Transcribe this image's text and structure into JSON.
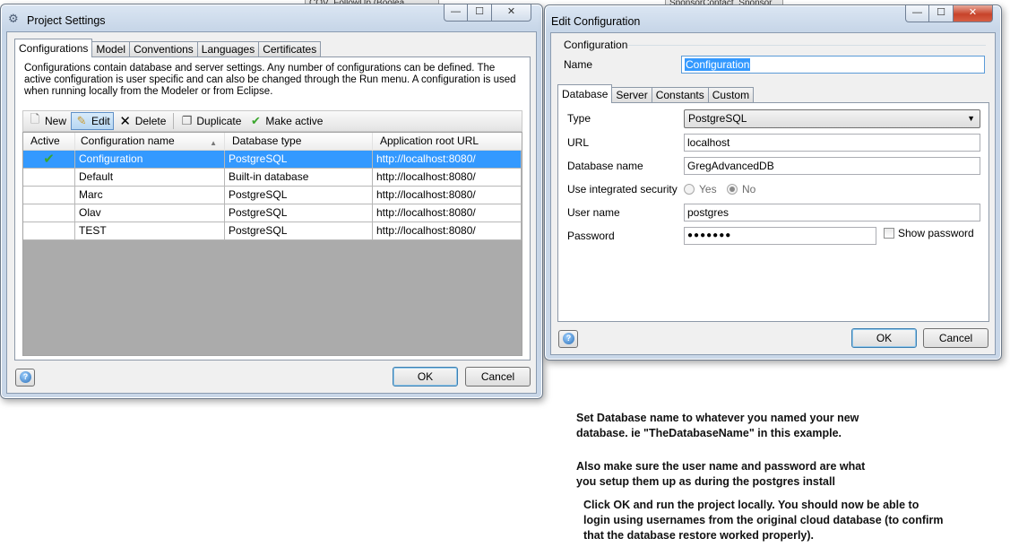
{
  "background": {
    "strip1": "COV_FollowUp (Boolea...",
    "strip2": "SponsorContact_Sponsor"
  },
  "project_settings": {
    "title": "Project Settings",
    "window_buttons": {
      "minimize": "—",
      "maximize": "☐",
      "close": "✕"
    },
    "tabs": [
      "Configurations",
      "Model",
      "Conventions",
      "Languages",
      "Certificates"
    ],
    "description": "Configurations contain database and server settings. Any number of configurations can be defined. The active configuration is user specific and can also be changed through the Run menu. A configuration is used when running locally from the Modeler or from Eclipse.",
    "toolbar": {
      "new": "New",
      "edit": "Edit",
      "delete": "Delete",
      "duplicate": "Duplicate",
      "make_active": "Make active"
    },
    "columns": [
      "Active",
      "Configuration name",
      "Database type",
      "Application root URL"
    ],
    "rows": [
      {
        "active": "✔",
        "name": "Configuration",
        "db": "PostgreSQL",
        "url": "http://localhost:8080/"
      },
      {
        "active": "",
        "name": "Default",
        "db": "Built-in database",
        "url": "http://localhost:8080/"
      },
      {
        "active": "",
        "name": "Marc",
        "db": "PostgreSQL",
        "url": "http://localhost:8080/"
      },
      {
        "active": "",
        "name": "Olav",
        "db": "PostgreSQL",
        "url": "http://localhost:8080/"
      },
      {
        "active": "",
        "name": "TEST",
        "db": "PostgreSQL",
        "url": "http://localhost:8080/"
      }
    ],
    "help": "?",
    "ok": "OK",
    "cancel": "Cancel"
  },
  "edit_configuration": {
    "title": "Edit Configuration",
    "window_buttons": {
      "minimize": "—",
      "maximize": "☐",
      "close": "✕"
    },
    "group_label": "Configuration",
    "name_label": "Name",
    "name_value": "Configuration",
    "tabs": [
      "Database",
      "Server",
      "Constants",
      "Custom"
    ],
    "type_label": "Type",
    "type_value": "PostgreSQL",
    "url_label": "URL",
    "url_value": "localhost",
    "dbname_label": "Database name",
    "dbname_value": "GregAdvancedDB",
    "integrated_label": "Use integrated security",
    "yes": "Yes",
    "no": "No",
    "username_label": "User name",
    "username_value": "postgres",
    "password_label": "Password",
    "password_value": "●●●●●●●",
    "show_password": "Show password",
    "help": "?",
    "ok": "OK",
    "cancel": "Cancel"
  },
  "notes": {
    "p1_line1": "Set  Database name to whatever you named your new",
    "p1_line2": "database.  ie \"TheDatabaseName\" in this example.",
    "p2_line1": "Also make sure the user name and password are what",
    "p2_line2": "you setup them up as during the postgres install",
    "p3_line1": "Click OK and run the project locally.  You should now be able to",
    "p3_line2": "login using usernames from the original cloud database (to confirm",
    "p3_line3": "that the database restore worked properly)."
  }
}
